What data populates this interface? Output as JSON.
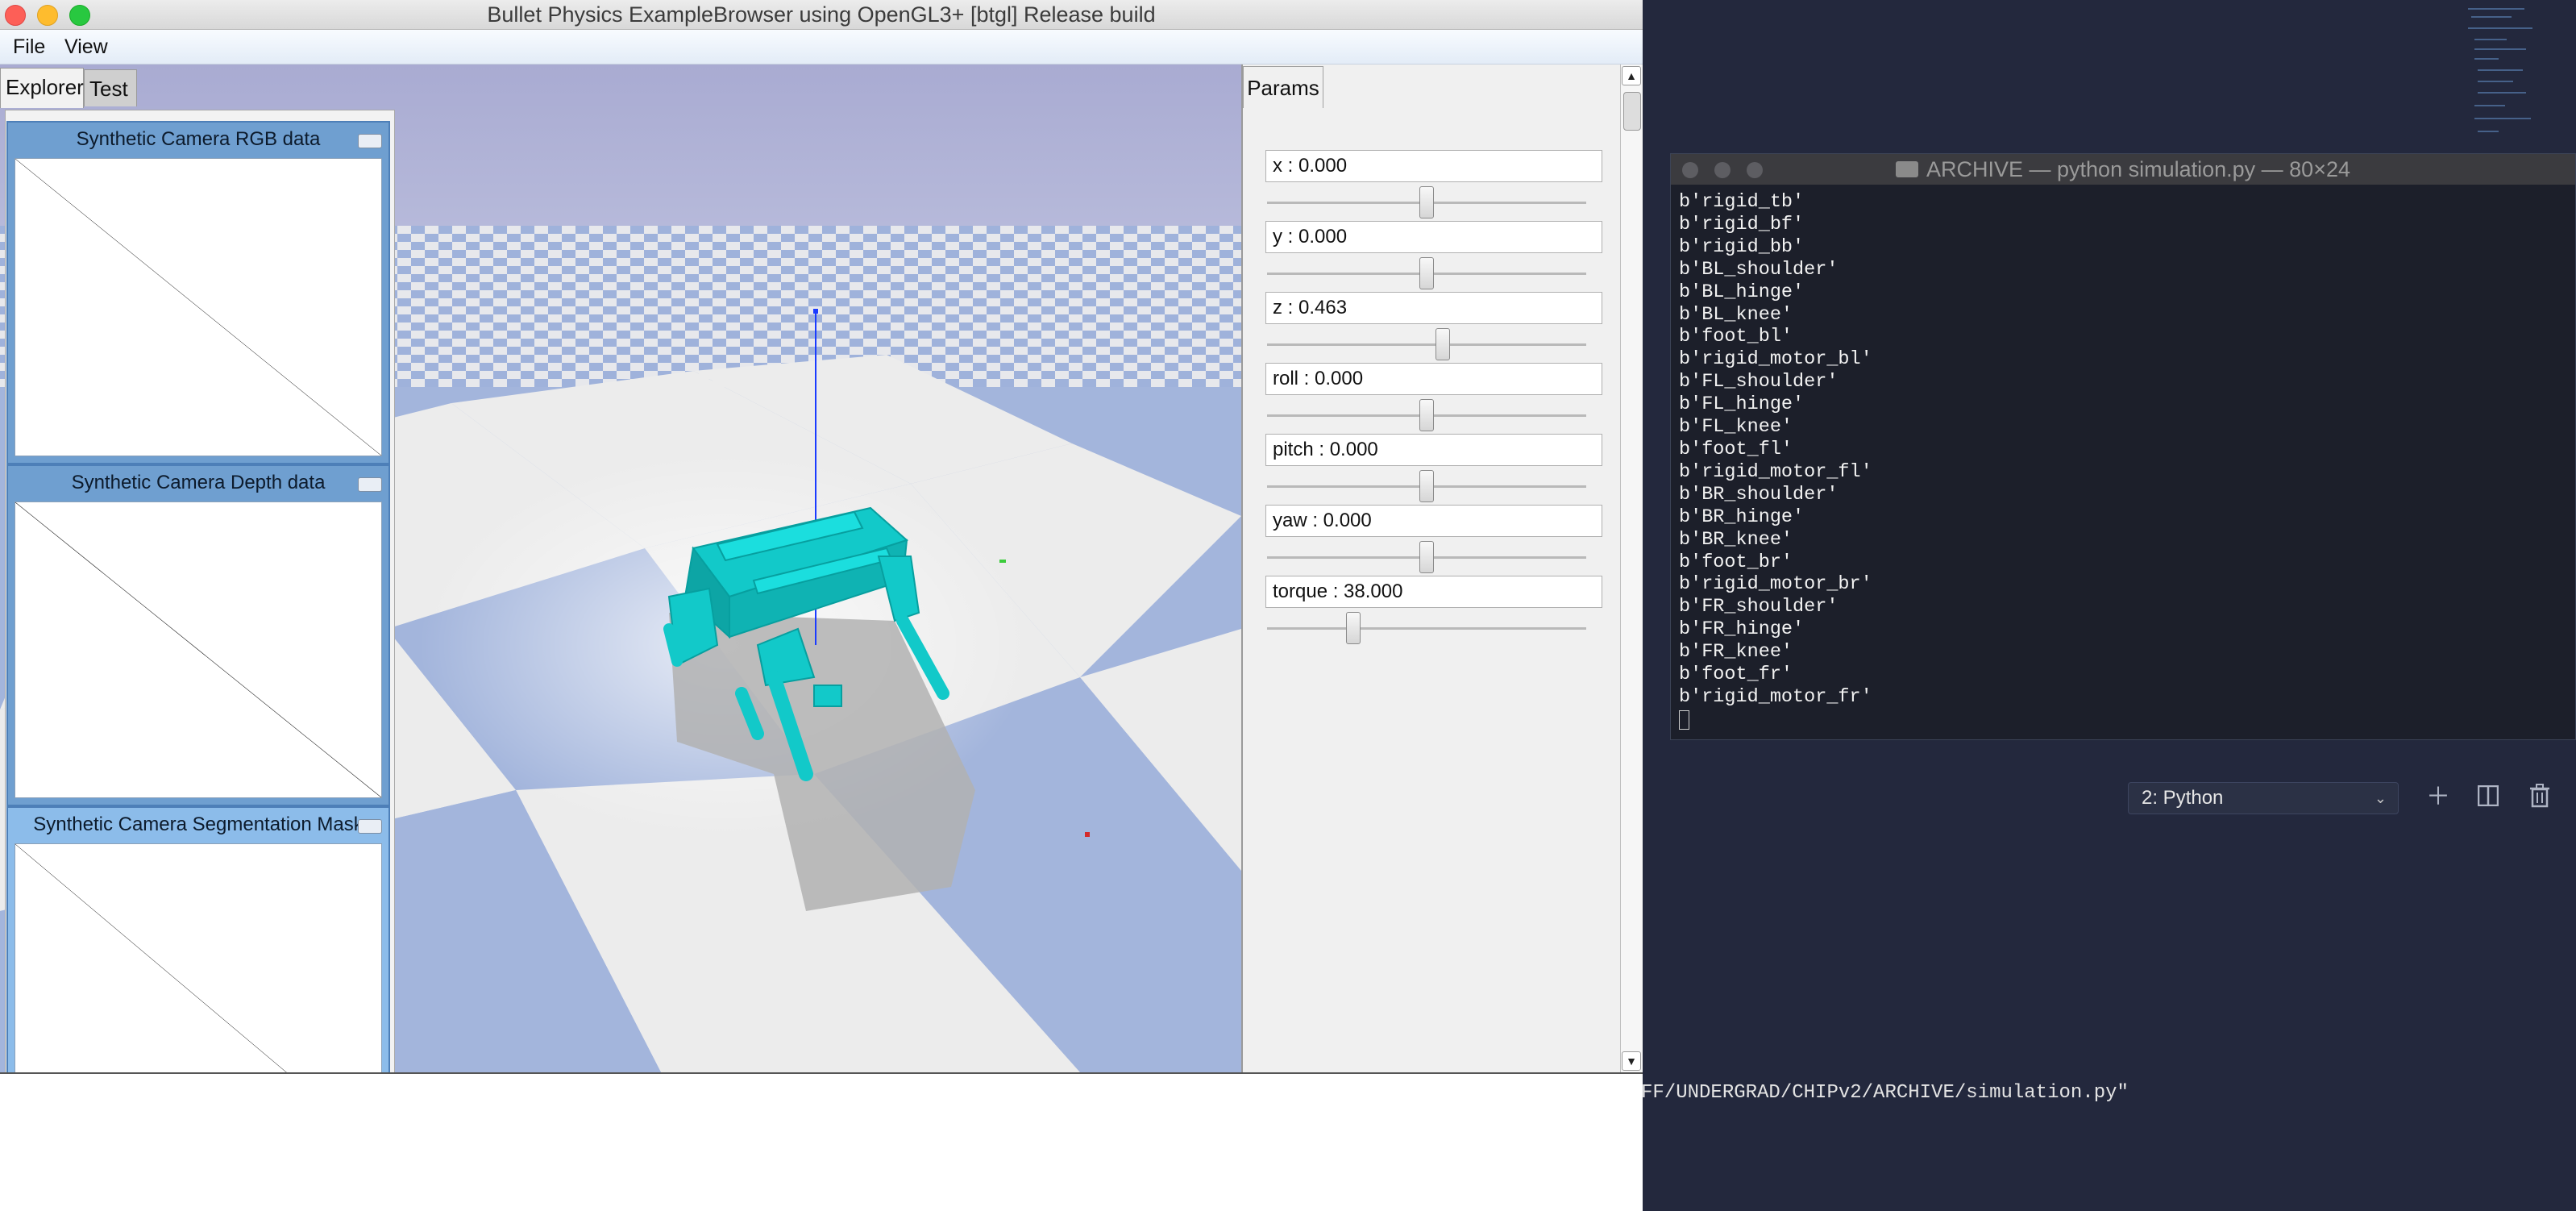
{
  "window": {
    "title": "Bullet Physics ExampleBrowser using OpenGL3+ [btgl] Release build"
  },
  "menu": {
    "file": "File",
    "view": "View"
  },
  "explorer": {
    "tabs": [
      "Explorer",
      "Test"
    ],
    "camera_windows": [
      {
        "title": "Synthetic Camera RGB data"
      },
      {
        "title": "Synthetic Camera Depth data"
      },
      {
        "title": "Synthetic Camera Segmentation Mask"
      }
    ]
  },
  "params": {
    "tab_label": "Params",
    "sliders": [
      {
        "label": "x : 0.000",
        "fraction": 0.5
      },
      {
        "label": "y : 0.000",
        "fraction": 0.5
      },
      {
        "label": "z : 0.463",
        "fraction": 0.55
      },
      {
        "label": "roll : 0.000",
        "fraction": 0.5
      },
      {
        "label": "pitch : 0.000",
        "fraction": 0.5
      },
      {
        "label": "yaw : 0.000",
        "fraction": 0.5
      },
      {
        "label": "torque : 38.000",
        "fraction": 0.27
      }
    ]
  },
  "terminal": {
    "title": "ARCHIVE — python simulation.py — 80×24",
    "lines": [
      "b'rigid_tb'",
      "b'rigid_bf'",
      "b'rigid_bb'",
      "b'BL_shoulder'",
      "b'BL_hinge'",
      "b'BL_knee'",
      "b'foot_bl'",
      "b'rigid_motor_bl'",
      "b'FL_shoulder'",
      "b'FL_hinge'",
      "b'FL_knee'",
      "b'foot_fl'",
      "b'rigid_motor_fl'",
      "b'BR_shoulder'",
      "b'BR_hinge'",
      "b'BR_knee'",
      "b'foot_br'",
      "b'rigid_motor_br'",
      "b'FR_shoulder'",
      "b'FR_hinge'",
      "b'FR_knee'",
      "b'foot_fr'",
      "b'rigid_motor_fr'"
    ],
    "selector": "2: Python",
    "path": "FF/UNDERGRAD/CHIPv2/ARCHIVE/simulation.py\""
  },
  "colors": {
    "sky": "#aeb1d4",
    "floor_blue": "#9fb2db",
    "floor_white": "#ededed",
    "robot": "#12c9c9"
  },
  "icons": {
    "add": "plus-icon",
    "split": "split-icon",
    "trash": "trash-icon",
    "chevron": "chevron-down-icon"
  }
}
